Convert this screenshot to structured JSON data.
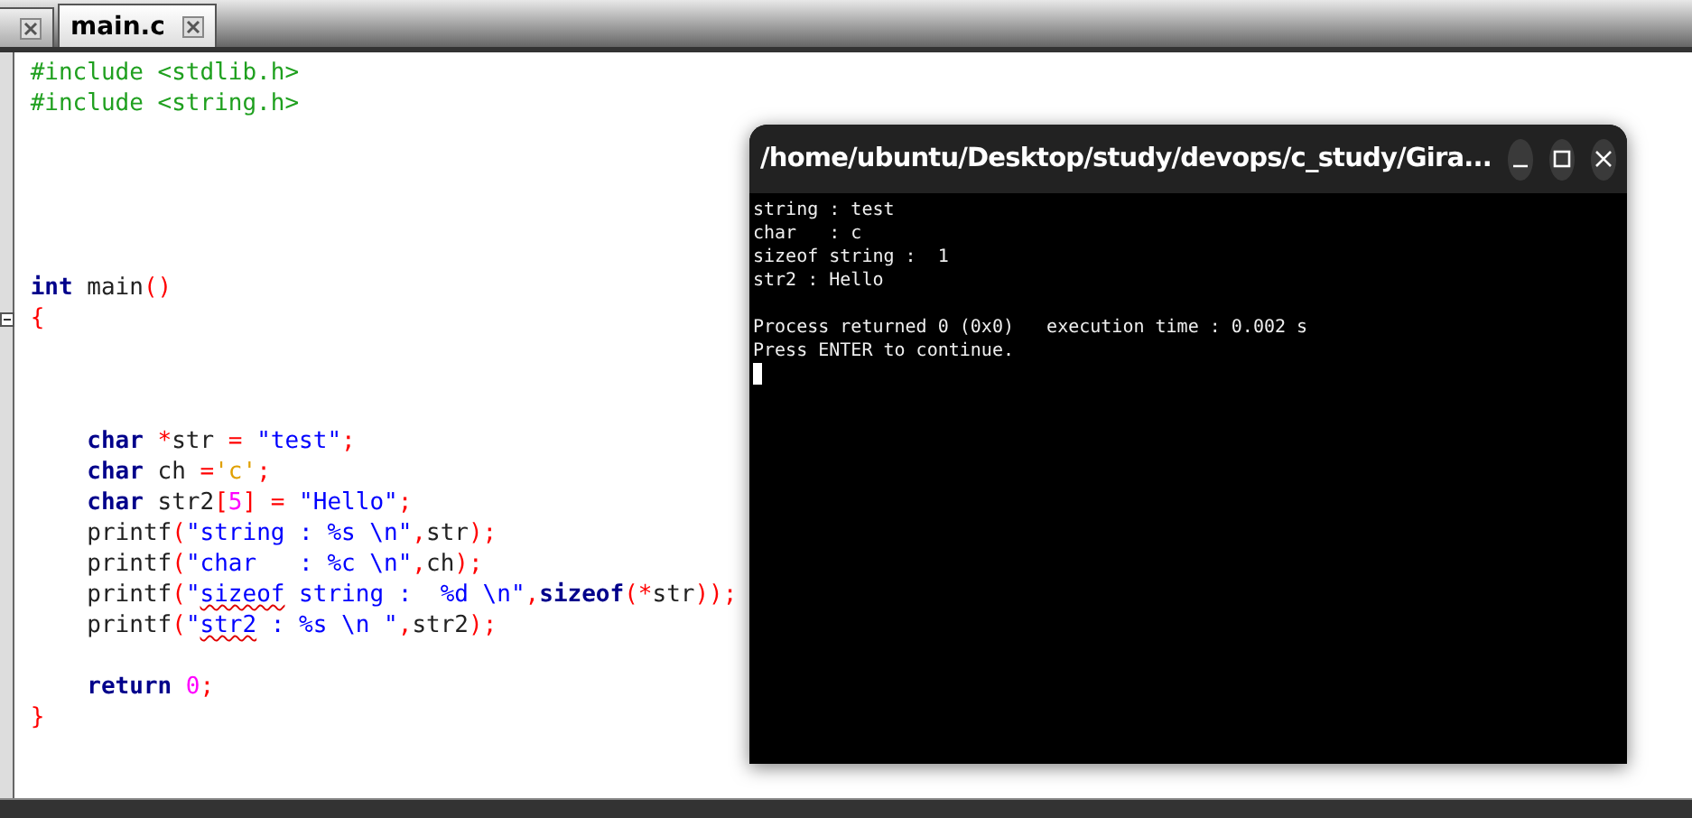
{
  "tabs": [
    {
      "selected": false
    },
    {
      "label": "main.c",
      "selected": true
    }
  ],
  "editor": {
    "lines": [
      {
        "kind": "code",
        "tokens": [
          {
            "kind": "preproc",
            "text": "#include <stdlib.h>"
          }
        ]
      },
      {
        "kind": "code",
        "tokens": [
          {
            "kind": "preproc",
            "text": "#include <string.h>"
          }
        ]
      },
      {
        "kind": "blank"
      },
      {
        "kind": "blank"
      },
      {
        "kind": "blank"
      },
      {
        "kind": "blank"
      },
      {
        "kind": "blank"
      },
      {
        "kind": "code",
        "tokens": [
          {
            "kind": "keyword",
            "text": "int"
          },
          {
            "kind": "plain",
            "text": " main"
          },
          {
            "kind": "punct",
            "text": "()"
          }
        ]
      },
      {
        "kind": "code",
        "folded": false,
        "tokens": [
          {
            "kind": "punct",
            "text": "{"
          }
        ]
      },
      {
        "kind": "blank"
      },
      {
        "kind": "blank"
      },
      {
        "kind": "blank"
      },
      {
        "kind": "code",
        "tokens": [
          {
            "kind": "keyword",
            "text": "    char"
          },
          {
            "kind": "punct",
            "text": " *"
          },
          {
            "kind": "plain",
            "text": "str "
          },
          {
            "kind": "punct",
            "text": "="
          },
          {
            "kind": "string",
            "text": " \"test\""
          },
          {
            "kind": "punct",
            "text": ";"
          }
        ]
      },
      {
        "kind": "code",
        "tokens": [
          {
            "kind": "keyword",
            "text": "    char"
          },
          {
            "kind": "plain",
            "text": " ch "
          },
          {
            "kind": "punct",
            "text": "="
          },
          {
            "kind": "char",
            "text": "'c'"
          },
          {
            "kind": "punct",
            "text": ";"
          }
        ]
      },
      {
        "kind": "code",
        "tokens": [
          {
            "kind": "keyword",
            "text": "    char"
          },
          {
            "kind": "plain",
            "text": " str2"
          },
          {
            "kind": "punct",
            "text": "["
          },
          {
            "kind": "number",
            "text": "5"
          },
          {
            "kind": "punct",
            "text": "] ="
          },
          {
            "kind": "string",
            "text": " \"Hello\""
          },
          {
            "kind": "punct",
            "text": ";"
          }
        ]
      },
      {
        "kind": "code",
        "tokens": [
          {
            "kind": "plain",
            "text": "    printf"
          },
          {
            "kind": "punct",
            "text": "("
          },
          {
            "kind": "string",
            "text": "\"string : %s \\n\""
          },
          {
            "kind": "punct",
            "text": ","
          },
          {
            "kind": "plain",
            "text": "str"
          },
          {
            "kind": "punct",
            "text": ");"
          }
        ]
      },
      {
        "kind": "code",
        "tokens": [
          {
            "kind": "plain",
            "text": "    printf"
          },
          {
            "kind": "punct",
            "text": "("
          },
          {
            "kind": "string",
            "text": "\"char   : %c \\n\""
          },
          {
            "kind": "punct",
            "text": ","
          },
          {
            "kind": "plain",
            "text": "ch"
          },
          {
            "kind": "punct",
            "text": ");"
          }
        ]
      },
      {
        "kind": "code",
        "tokens": [
          {
            "kind": "plain",
            "text": "    printf"
          },
          {
            "kind": "punct",
            "text": "("
          },
          {
            "kind": "string",
            "text": "\""
          },
          {
            "kind": "string",
            "text": "sizeof",
            "misspelled": true
          },
          {
            "kind": "string",
            "text": " string :  %d \\n\""
          },
          {
            "kind": "punct",
            "text": ","
          },
          {
            "kind": "keyword",
            "text": "sizeof"
          },
          {
            "kind": "punct",
            "text": "(*"
          },
          {
            "kind": "plain",
            "text": "str"
          },
          {
            "kind": "punct",
            "text": "));"
          }
        ]
      },
      {
        "kind": "code",
        "tokens": [
          {
            "kind": "plain",
            "text": "    printf"
          },
          {
            "kind": "punct",
            "text": "("
          },
          {
            "kind": "string",
            "text": "\""
          },
          {
            "kind": "string",
            "text": "str2",
            "misspelled": true
          },
          {
            "kind": "string",
            "text": " : %s \\n \""
          },
          {
            "kind": "punct",
            "text": ","
          },
          {
            "kind": "plain",
            "text": "str2"
          },
          {
            "kind": "punct",
            "text": ");"
          }
        ]
      },
      {
        "kind": "blank"
      },
      {
        "kind": "code",
        "tokens": [
          {
            "kind": "keyword",
            "text": "    return"
          },
          {
            "kind": "number",
            "text": " 0"
          },
          {
            "kind": "punct",
            "text": ";"
          }
        ]
      },
      {
        "kind": "code",
        "tokens": [
          {
            "kind": "punct",
            "text": "}"
          }
        ]
      }
    ]
  },
  "terminal": {
    "title": "/home/ubuntu/Desktop/study/devops/c_study/Gira...",
    "output": [
      {
        "kind": "text",
        "text": "string : test"
      },
      {
        "kind": "text",
        "text": "char   : c"
      },
      {
        "kind": "text",
        "text": "sizeof string :  1"
      },
      {
        "kind": "text",
        "text": "str2 : Hello"
      },
      {
        "kind": "blank"
      },
      {
        "kind": "text",
        "text": "Process returned 0 (0x0)   execution time : 0.002 s"
      },
      {
        "kind": "text",
        "text": "Press ENTER to continue."
      }
    ],
    "cursor": true
  }
}
